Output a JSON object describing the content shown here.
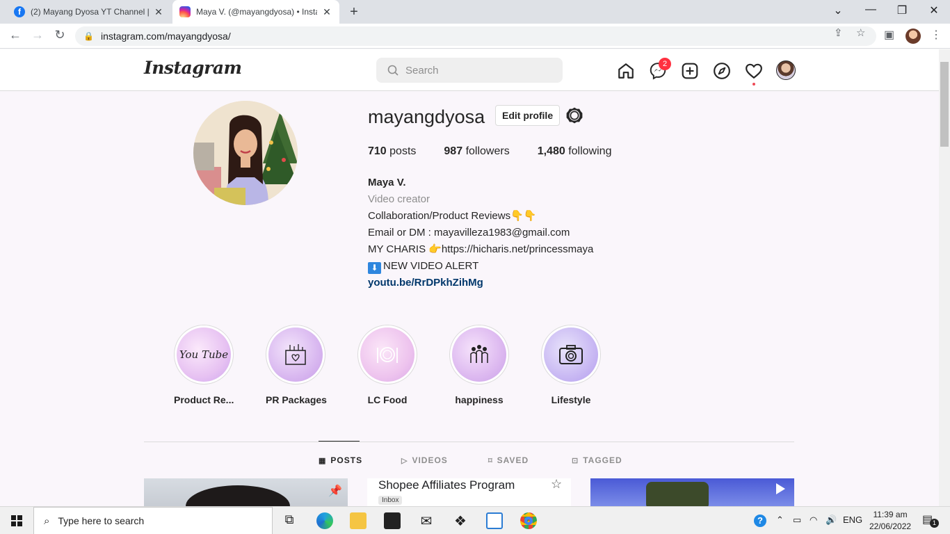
{
  "browser": {
    "tabs": [
      {
        "title": "(2) Mayang Dyosa YT Channel | F",
        "favicon": "facebook-icon",
        "color": "#1877f2"
      },
      {
        "title": "Maya V. (@mayangdyosa) • Insta",
        "favicon": "instagram-icon",
        "color": "#d6249f"
      }
    ],
    "url": "instagram.com/mayangdyosa/"
  },
  "instagram": {
    "logo": "Instagram",
    "search_placeholder": "Search",
    "messenger_badge": "2",
    "profile": {
      "username": "mayangdyosa",
      "edit_label": "Edit profile",
      "stats": [
        {
          "count": "710",
          "label": "posts"
        },
        {
          "count": "987",
          "label": "followers"
        },
        {
          "count": "1,480",
          "label": "following"
        }
      ],
      "bio": {
        "name": "Maya V.",
        "category": "Video creator",
        "line1": "Collaboration/Product Reviews👇👇",
        "line2": "Email or DM : mayavilleza1983@gmail.com",
        "line3": "MY CHARIS 👉https://hicharis.net/princessmaya",
        "line4_icon": "⬇",
        "line4": "NEW VIDEO ALERT",
        "link": "youtu.be/RrDPkhZihMg"
      }
    },
    "highlights": [
      {
        "label": "Product Re...",
        "icon": "youtube-script-icon",
        "text": "You Tube"
      },
      {
        "label": "PR Packages",
        "icon": "gift-box-icon",
        "text": ""
      },
      {
        "label": "LC Food",
        "icon": "plate-cutlery-icon",
        "text": ""
      },
      {
        "label": "happiness",
        "icon": "people-icon",
        "text": ""
      },
      {
        "label": "Lifestyle",
        "icon": "camera-icon",
        "text": ""
      }
    ],
    "profile_tabs": [
      {
        "label": "POSTS",
        "icon": "▦",
        "active": true
      },
      {
        "label": "VIDEOS",
        "icon": "▷",
        "active": false
      },
      {
        "label": "SAVED",
        "icon": "⌑",
        "active": false
      },
      {
        "label": "TAGGED",
        "icon": "⊡",
        "active": false
      }
    ],
    "posts": [
      {
        "caption": ""
      },
      {
        "caption": "Shopee Affiliates Program",
        "tag": "Inbox"
      },
      {
        "caption": ""
      }
    ]
  },
  "taskbar": {
    "search_text": "Type here to search",
    "language": "ENG",
    "time": "11:39 am",
    "date": "22/06/2022",
    "notifications": "1"
  }
}
